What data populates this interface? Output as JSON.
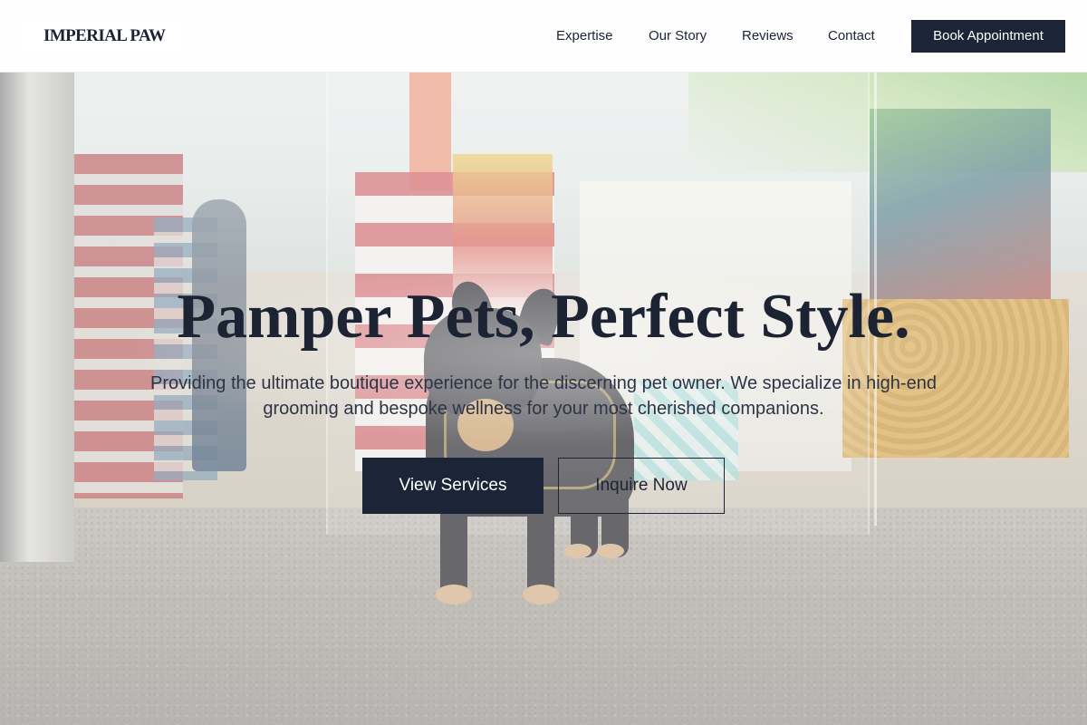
{
  "brand": {
    "name": "IMPERIAL PAW"
  },
  "nav": {
    "items": [
      {
        "label": "Expertise"
      },
      {
        "label": "Our Story"
      },
      {
        "label": "Reviews"
      },
      {
        "label": "Contact"
      }
    ],
    "cta_label": "Book Appointment"
  },
  "hero": {
    "headline": "Pamper Pets, Perfect Style.",
    "subtext": "Providing the ultimate boutique experience for the discerning pet owner. We specialize in high-end grooming and bespoke wellness for your most cherished companions.",
    "primary_button": "View Services",
    "secondary_button": "Inquire Now",
    "background_image": "french-bulldog-in-pet-store-photo"
  },
  "colors": {
    "primary": "#1c2538",
    "text": "#1c2333",
    "header_bg": "#ffffff"
  }
}
